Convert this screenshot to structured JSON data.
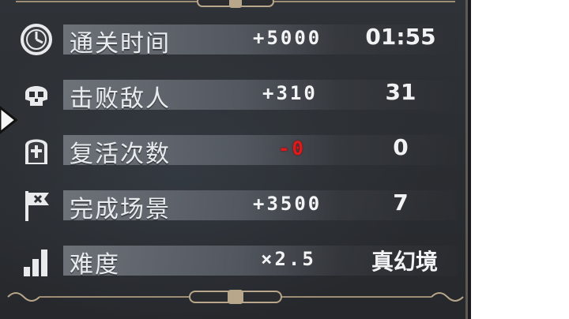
{
  "rows": [
    {
      "label": "通关时间",
      "bonus": "+5000",
      "value": "01:55",
      "icon": "clock-icon"
    },
    {
      "label": "击败敌人",
      "bonus": "+310",
      "value": "31",
      "icon": "skull-icon"
    },
    {
      "label": "复活次数",
      "bonus": "-0",
      "value": "0",
      "icon": "tombstone-icon"
    },
    {
      "label": "完成场景",
      "bonus": "+3500",
      "value": "7",
      "icon": "flag-icon"
    },
    {
      "label": "难度",
      "bonus": "×2.5",
      "value": "真幻境",
      "icon": "difficulty-bars-icon"
    }
  ],
  "colors": {
    "panel": "#2b2e32",
    "band": "#7a7f86",
    "text": "#e9ecef",
    "negative": "#e01a1a",
    "ornament": "#b8a78a"
  }
}
